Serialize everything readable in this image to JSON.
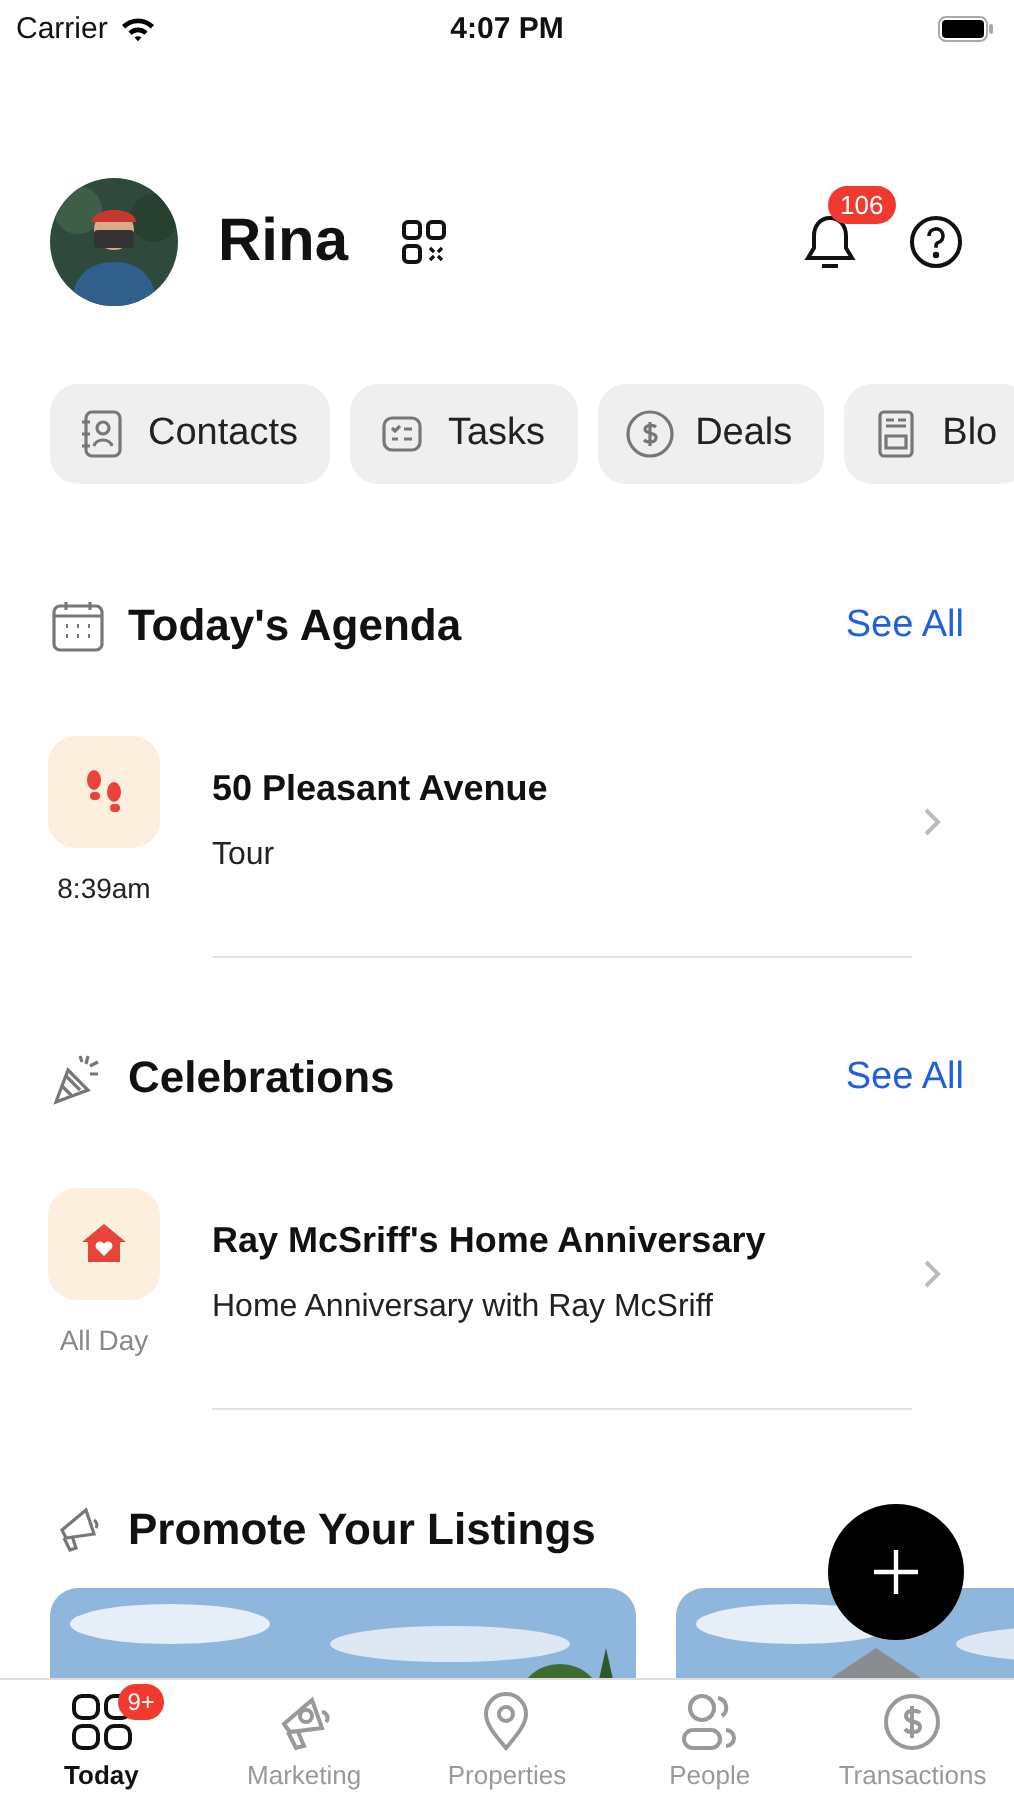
{
  "status_bar": {
    "carrier": "Carrier",
    "time": "4:07 PM"
  },
  "profile": {
    "name": "Rina",
    "notifications_badge": "106"
  },
  "shortcuts": [
    {
      "label": "Contacts",
      "kind": "contacts"
    },
    {
      "label": "Tasks",
      "kind": "tasks"
    },
    {
      "label": "Deals",
      "kind": "deals"
    },
    {
      "label": "Blo",
      "kind": "blog"
    }
  ],
  "sections": [
    {
      "kind": "agenda",
      "title": "Today's Agenda",
      "see_all": "See All",
      "items": [
        {
          "kind": "tour",
          "time": "8:39am",
          "title": "50 Pleasant Avenue",
          "subtitle": "Tour"
        }
      ]
    },
    {
      "kind": "celebrations",
      "title": "Celebrations",
      "see_all": "See All",
      "items": [
        {
          "kind": "anniversary",
          "time": "All Day",
          "title": "Ray McSriff's Home Anniversary",
          "subtitle": "Home Anniversary with Ray McSriff"
        }
      ]
    },
    {
      "kind": "promote",
      "title": "Promote Your Listings"
    }
  ],
  "tab_bar": [
    {
      "label": "Today",
      "kind": "today",
      "selected": true,
      "badge": "9+"
    },
    {
      "label": "Marketing",
      "kind": "marketing",
      "selected": false
    },
    {
      "label": "Properties",
      "kind": "properties",
      "selected": false
    },
    {
      "label": "People",
      "kind": "people",
      "selected": false
    },
    {
      "label": "Transactions",
      "kind": "transactions",
      "selected": false
    }
  ]
}
